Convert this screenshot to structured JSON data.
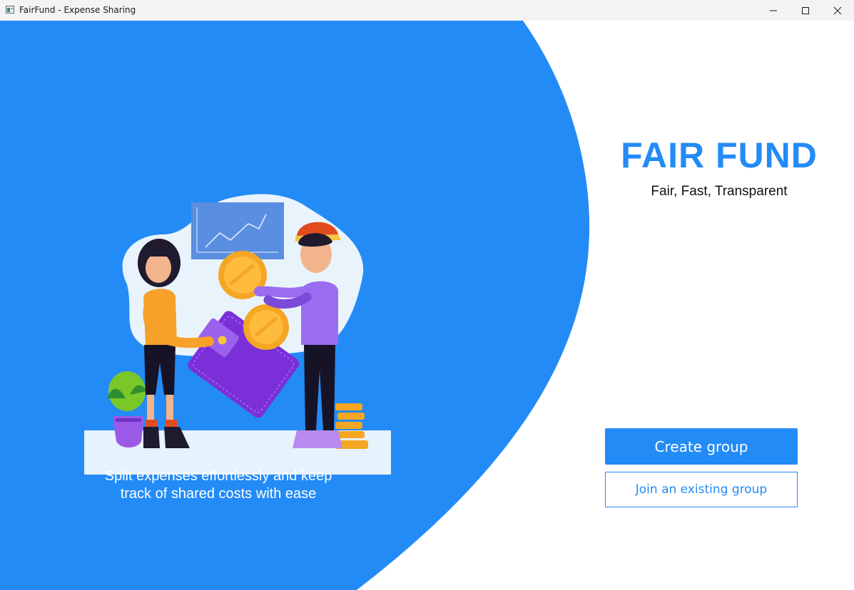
{
  "window": {
    "title": "FairFund - Expense Sharing",
    "icon": "app-window-icon",
    "controls": [
      "minimize-icon",
      "maximize-icon",
      "close-icon"
    ]
  },
  "hero": {
    "illustration": "two-people-sharing-money-illustration",
    "tagline_line1": "Split expenses effortlessly and keep",
    "tagline_line2": "track of shared costs with ease"
  },
  "brand": {
    "name": "FAIR FUND",
    "tagline": "Fair, Fast, Transparent"
  },
  "actions": {
    "create_label": "Create group",
    "join_label": "Join an existing group"
  },
  "colors": {
    "accent": "#238bf6",
    "background": "#ffffff",
    "titlebar": "#f3f3f3"
  }
}
